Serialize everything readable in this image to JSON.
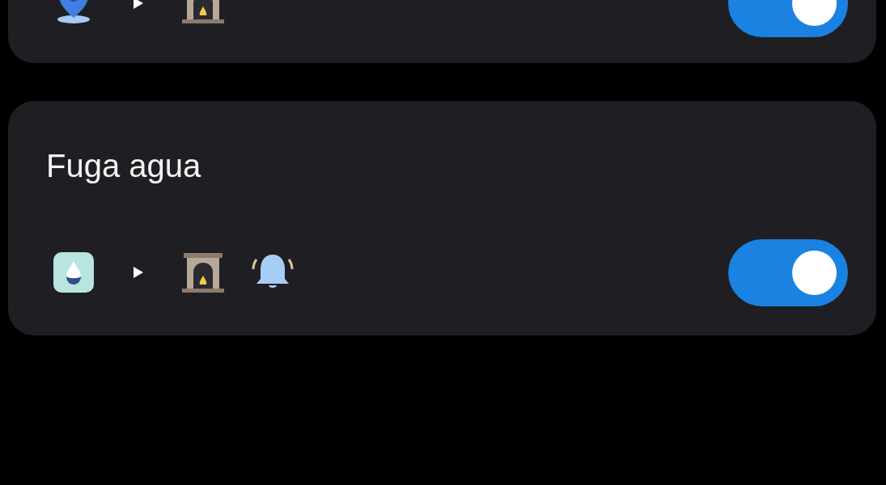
{
  "routines": [
    {
      "conditions": [
        {
          "kind": "location"
        }
      ],
      "actions": [
        {
          "kind": "fireplace"
        }
      ],
      "on": true
    },
    {
      "title": "Fuga agua",
      "conditions": [
        {
          "kind": "water-leak"
        }
      ],
      "actions": [
        {
          "kind": "fireplace"
        },
        {
          "kind": "bell"
        }
      ],
      "on": true
    }
  ]
}
